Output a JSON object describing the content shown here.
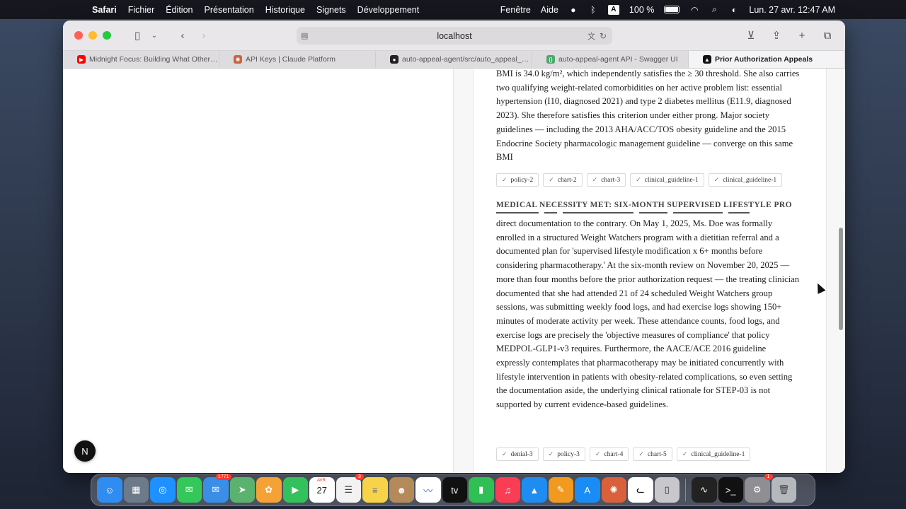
{
  "menubar": {
    "app": "Safari",
    "items": [
      "Fichier",
      "Édition",
      "Présentation",
      "Historique",
      "Signets",
      "Développement"
    ],
    "right_items": [
      "Fenêtre",
      "Aide"
    ],
    "input_source": "A",
    "battery": "100 %",
    "datetime": "Lun. 27 avr.  12:47 AM"
  },
  "browser": {
    "url": "localhost",
    "tabs": [
      {
        "label": "Midnight Focus: Building What Others C...",
        "icon": "youtube-icon"
      },
      {
        "label": "API Keys | Claude Platform",
        "icon": "claude-icon"
      },
      {
        "label": "auto-appeal-agent/src/auto_appeal_age...",
        "icon": "github-icon"
      },
      {
        "label": "auto-appeal-agent API - Swagger UI",
        "icon": "swagger-icon"
      },
      {
        "label": "Prior Authorization Appeals",
        "icon": "app-icon",
        "active": true
      }
    ]
  },
  "document": {
    "para1": "BMI is 34.0 kg/m², which independently satisfies the ≥ 30 threshold. She also carries two qualifying weight-related comorbidities on her active problem list: essential hypertension (I10, diagnosed 2021) and type 2 diabetes mellitus (E11.9, diagnosed 2023). She therefore satisfies this criterion under either prong. Major society guidelines — including the 2013 AHA/ACC/TOS obesity guideline and the 2015 Endocrine Society pharmacologic management guideline — converge on this same BMI",
    "citations1": [
      "policy-2",
      "chart-2",
      "chart-3",
      "clinical_guideline-1",
      "clinical_guideline-1"
    ],
    "section_heading": "MEDICAL NECESSITY MET: SIX-MONTH SUPERVISED LIFESTYLE PRO",
    "para2": "direct documentation to the contrary. On May 1, 2025, Ms. Doe was formally enrolled in a structured Weight Watchers program with a dietitian referral and a documented plan for 'supervised lifestyle modification x 6+ months before considering pharmacotherapy.' At the six-month review on November 20, 2025 — more than four months before the prior authorization request — the treating clinician documented that she had attended 21 of 24 scheduled Weight Watchers group sessions, was submitting weekly food logs, and had exercise logs showing 150+ minutes of moderate activity per week. These attendance counts, food logs, and exercise logs are precisely the 'objective measures of compliance' that policy MEDPOL-GLP1-v3 requires. Furthermore, the AACE/ACE 2016 guideline expressly contemplates that pharmacotherapy may be initiated concurrently with lifestyle intervention in patients with obesity-related complications, so even setting the documentation aside, the underlying clinical rationale for STEP-03 is not supported by current evidence-based guidelines.",
    "citations2": [
      "denial-3",
      "policy-3",
      "chart-4",
      "chart-5",
      "clinical_guideline-1"
    ]
  },
  "overlay": {
    "dev_badge": "N"
  },
  "dock": {
    "apps": [
      {
        "name": "finder",
        "color": "#2f8cf0",
        "glyph": "☺"
      },
      {
        "name": "launchpad",
        "color": "#6c7a8a",
        "glyph": "▦"
      },
      {
        "name": "safari",
        "color": "#1e90ff",
        "glyph": "◎"
      },
      {
        "name": "messages",
        "color": "#34c759",
        "glyph": "✉"
      },
      {
        "name": "mail",
        "color": "#3a8ee6",
        "glyph": "✉",
        "badge": "1771"
      },
      {
        "name": "maps",
        "color": "#5bb26f",
        "glyph": "➤"
      },
      {
        "name": "photos",
        "color": "#f4a236",
        "glyph": "✿"
      },
      {
        "name": "facetime",
        "color": "#32c15a",
        "glyph": "▶"
      },
      {
        "name": "calendar",
        "color": "#ffffff",
        "glyph": "27",
        "text_color": "#222",
        "caption": "AVR."
      },
      {
        "name": "reminders",
        "color": "#f2f2f2",
        "glyph": "☰",
        "text_color": "#444",
        "badge": "3"
      },
      {
        "name": "notes",
        "color": "#f8d34a",
        "glyph": "≡",
        "text_color": "#666"
      },
      {
        "name": "contacts",
        "color": "#b48a5a",
        "glyph": "☻"
      },
      {
        "name": "freeform",
        "color": "#ffffff",
        "glyph": "〰",
        "text_color": "#2a6cd6"
      },
      {
        "name": "tv",
        "color": "#111111",
        "glyph": "tv"
      },
      {
        "name": "numbers",
        "color": "#2fbf55",
        "glyph": "▮"
      },
      {
        "name": "music",
        "color": "#fa3d55",
        "glyph": "♫"
      },
      {
        "name": "keynote",
        "color": "#1f8cf2",
        "glyph": "▲"
      },
      {
        "name": "pages",
        "color": "#f29a1f",
        "glyph": "✎"
      },
      {
        "name": "app-store",
        "color": "#1a8cf5",
        "glyph": "A"
      },
      {
        "name": "claude",
        "color": "#d9603b",
        "glyph": "✺"
      },
      {
        "name": "chatgpt-cat",
        "color": "#ffffff",
        "glyph": "ᓚ",
        "text_color": "#111"
      },
      {
        "name": "iphone-mirroring",
        "color": "#c8c8cc",
        "glyph": "▯",
        "text_color": "#333"
      },
      {
        "name": "activity-monitor",
        "color": "#222222",
        "glyph": "∿"
      },
      {
        "name": "terminal",
        "color": "#111111",
        "glyph": ">_"
      },
      {
        "name": "system-settings",
        "color": "#8e8e93",
        "glyph": "⚙",
        "badge": "1"
      },
      {
        "name": "trash",
        "color": "#b5b8bd",
        "glyph": "🗑",
        "text_color": "#444"
      }
    ]
  }
}
